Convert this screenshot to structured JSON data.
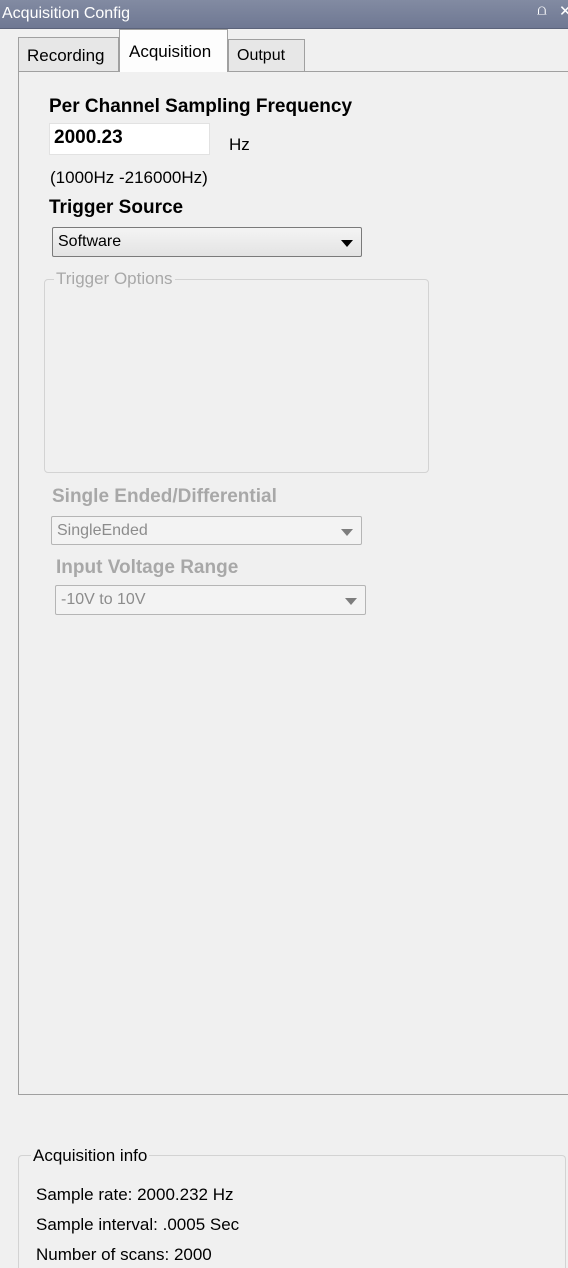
{
  "window": {
    "title": "Acquisition Config",
    "pin_icon": "pin-icon",
    "close_icon": "close-icon"
  },
  "tabs": [
    {
      "label": "Recording",
      "active": false
    },
    {
      "label": "Acquisition",
      "active": true
    },
    {
      "label": "Output",
      "active": false
    }
  ],
  "acquisition": {
    "sampling_frequency_label": "Per Channel Sampling Frequency",
    "sampling_frequency_value": "2000.23",
    "sampling_frequency_unit": "Hz",
    "sampling_frequency_range": "(1000Hz -216000Hz)",
    "trigger_source_label": "Trigger Source",
    "trigger_source_value": "Software",
    "trigger_options_label": "Trigger Options",
    "input_mode_label": "Single Ended/Differential",
    "input_mode_value": "SingleEnded",
    "voltage_range_label": "Input Voltage Range",
    "voltage_range_value": "-10V to 10V"
  },
  "info": {
    "title": "Acquisition info",
    "sample_rate": "Sample rate: 2000.232 Hz",
    "sample_interval": "Sample interval: .0005 Sec",
    "number_of_scans": "Number of scans: 2000"
  },
  "colors": {
    "titlebar": "#7a8299",
    "disabled_text": "#a8a8a8",
    "background": "#f0f0f0"
  }
}
